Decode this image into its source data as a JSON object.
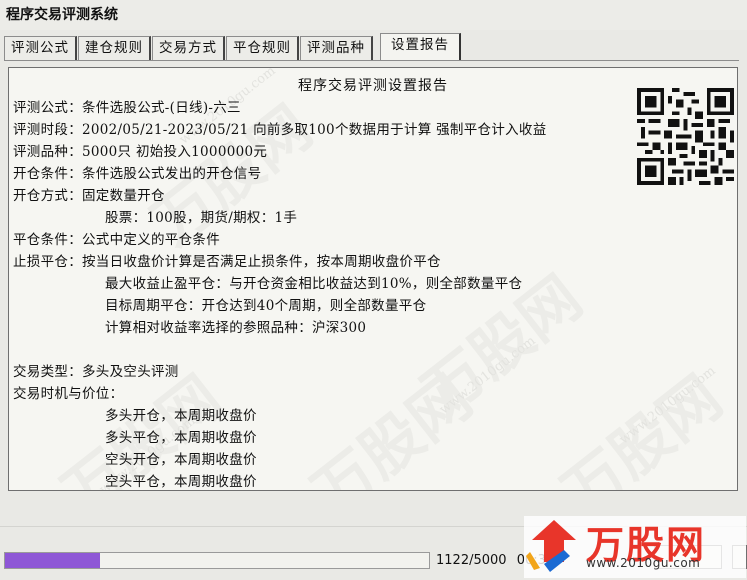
{
  "window": {
    "title": "程序交易评测系统"
  },
  "tabs": [
    {
      "label": "评测公式"
    },
    {
      "label": "建仓规则"
    },
    {
      "label": "交易方式"
    },
    {
      "label": "平仓规则"
    },
    {
      "label": "评测品种"
    },
    {
      "label": "设置报告"
    }
  ],
  "active_tab": "设置报告",
  "report": {
    "title": "程序交易评测设置报告",
    "lines": [
      "评测公式：条件选股公式-(日线)-六三",
      "评测时段：2002/05/21-2023/05/21 向前多取100个数据用于计算 强制平仓计入收益",
      "评测品种：5000只 初始投入1000000元",
      "开仓条件：条件选股公式发出的开仓信号",
      "开仓方式：固定数量开仓",
      "股票：100股，期货/期权：1手",
      "平仓条件：公式中定义的平仓条件",
      "止损平仓：按当日收盘价计算是否满足止损条件，按本周期收盘价平仓",
      "最大收益止盈平仓：与开仓资金相比收益达到10%，则全部数量平仓",
      "目标周期平仓：开仓达到40个周期，则全部数量平仓",
      "计算相对收益率选择的参照品种：沪深300",
      "交易类型：多头及空头评测",
      "交易时机与价位：",
      "多头开仓，本周期收盘价",
      "多头平仓，本周期收盘价",
      "空头开仓，本周期收盘价",
      "空头平仓，本周期收盘价"
    ]
  },
  "progress": {
    "fraction": 0.2244,
    "counter": "1122/5000",
    "elapsed": "00:3"
  },
  "watermark": {
    "brand": "万股网",
    "url": "www.2010gu.com"
  },
  "icons": {
    "qr": "qr-code-icon",
    "logo": "wangu-logo-icon"
  },
  "colors": {
    "progress": "#8e57d6",
    "brand_red": "#e8352a",
    "brand_blue": "#1b6ad3"
  }
}
